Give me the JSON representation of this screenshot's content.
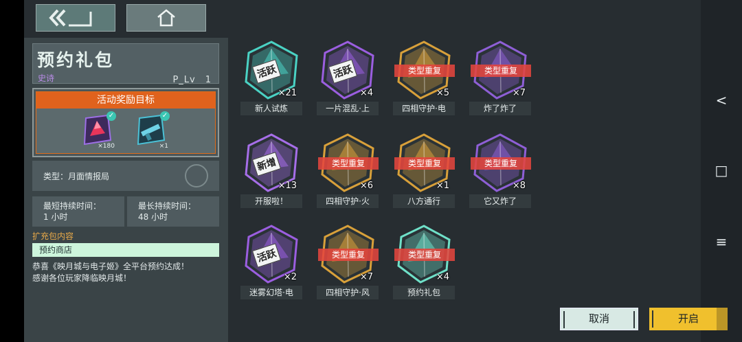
{
  "nav": {
    "back_icon": "back-arrow-icon",
    "home_icon": "home-icon"
  },
  "pack": {
    "title": "预约礼包",
    "rarity": "史诗",
    "level": "P_Lv　1",
    "reward_header": "活动奖励目标",
    "rewards": [
      {
        "icon": "red-crystal-icon",
        "qty": "×180"
      },
      {
        "icon": "weapon-icon",
        "qty": "×1"
      }
    ],
    "type": "类型：月面情报局",
    "min_duration_label": "最短持续时间：",
    "min_duration_value": "1 小时",
    "max_duration_label": "最长持续时间：",
    "max_duration_value": "48 小时",
    "expansion_label": "扩充包内容",
    "shop": "预约商店",
    "description_line1": "恭喜《映月城与电子姬》全平台预约达成！",
    "description_line2": "感谢各位玩家降临映月城！"
  },
  "duplicate_label": "类型重复",
  "stamps": {
    "active": "活跃",
    "new": "新增"
  },
  "items": [
    {
      "name": "新人试炼",
      "count": "×21",
      "color": "#4ad2c4",
      "stamp": "active",
      "duplicate": false
    },
    {
      "name": "一片混乱·上",
      "count": "×4",
      "color": "#9b5ee0",
      "stamp": "active",
      "duplicate": false
    },
    {
      "name": "四相守护·电",
      "count": "×5",
      "color": "#d8a03a",
      "stamp": "",
      "duplicate": true
    },
    {
      "name": "炸了炸了",
      "count": "×7",
      "color": "#8e5fd6",
      "stamp": "",
      "duplicate": true
    },
    {
      "name": "开服啦！",
      "count": "×13",
      "color": "#a66ee8",
      "stamp": "new",
      "duplicate": false
    },
    {
      "name": "四相守护·火",
      "count": "×6",
      "color": "#d8a03a",
      "stamp": "",
      "duplicate": true
    },
    {
      "name": "八方通行",
      "count": "×1",
      "color": "#d8a03a",
      "stamp": "",
      "duplicate": true
    },
    {
      "name": "它又炸了",
      "count": "×8",
      "color": "#8e5fd6",
      "stamp": "",
      "duplicate": true
    },
    {
      "name": "迷雾幻塔·电",
      "count": "×2",
      "color": "#9b5ee0",
      "stamp": "active",
      "duplicate": false
    },
    {
      "name": "四相守护·风",
      "count": "×7",
      "color": "#d8a03a",
      "stamp": "",
      "duplicate": true
    },
    {
      "name": "预约礼包",
      "count": "×4",
      "color": "#6fe0c8",
      "stamp": "",
      "duplicate": true
    }
  ],
  "buttons": {
    "cancel": "取消",
    "open": "开启"
  },
  "system_nav": {
    "back": "<",
    "home": "□",
    "menu": "≡"
  }
}
